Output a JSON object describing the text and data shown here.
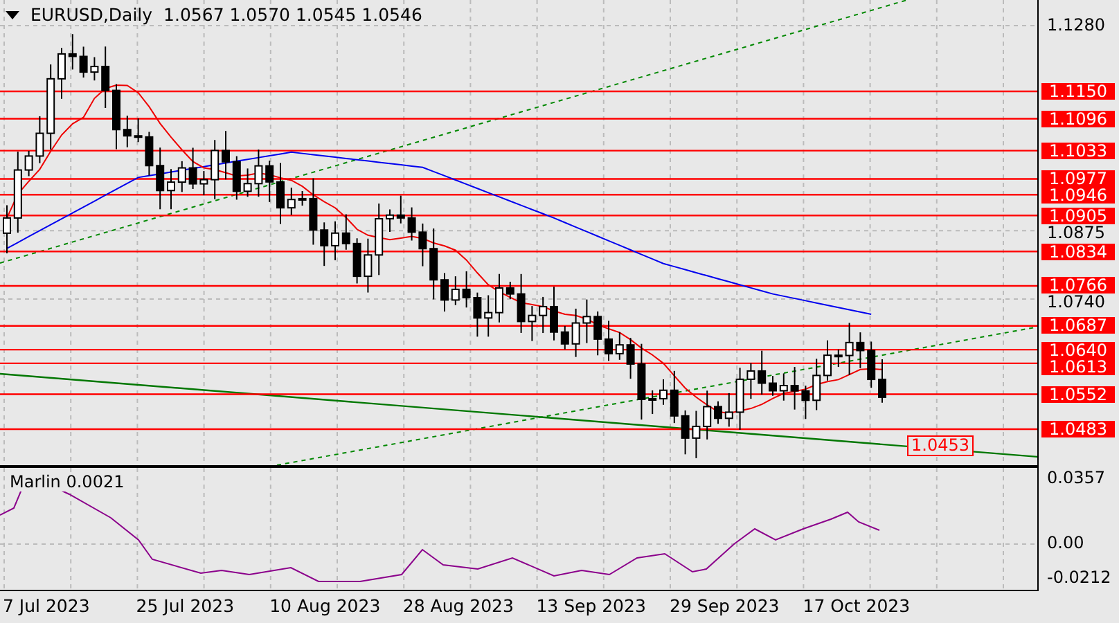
{
  "header": {
    "symbol": "EURUSD,Daily",
    "ohlc": "1.0567 1.0570 1.0545 1.0546"
  },
  "price_axis": {
    "ticks": [
      "1.1280",
      "1.0875",
      "1.0740"
    ]
  },
  "levels": [
    {
      "label": "1.1150"
    },
    {
      "label": "1.1096"
    },
    {
      "label": "1.1033"
    },
    {
      "label": "1.0977"
    },
    {
      "label": "1.0946"
    },
    {
      "label": "1.0905"
    },
    {
      "label": "1.0834"
    },
    {
      "label": "1.0766"
    },
    {
      "label": "1.0687"
    },
    {
      "label": "1.0640"
    },
    {
      "label": "1.0613"
    },
    {
      "label": "1.0552"
    },
    {
      "label": "1.0483"
    }
  ],
  "price_marker": {
    "label": "1.0453"
  },
  "indicator": {
    "label": "Marlin 0.0021",
    "ticks": [
      "0.0357",
      "0.00",
      "-0.0212"
    ]
  },
  "dates": [
    "7 Jul 2023",
    "25 Jul 2023",
    "10 Aug 2023",
    "28 Aug 2023",
    "13 Sep 2023",
    "29 Sep 2023",
    "17 Oct 2023"
  ]
}
